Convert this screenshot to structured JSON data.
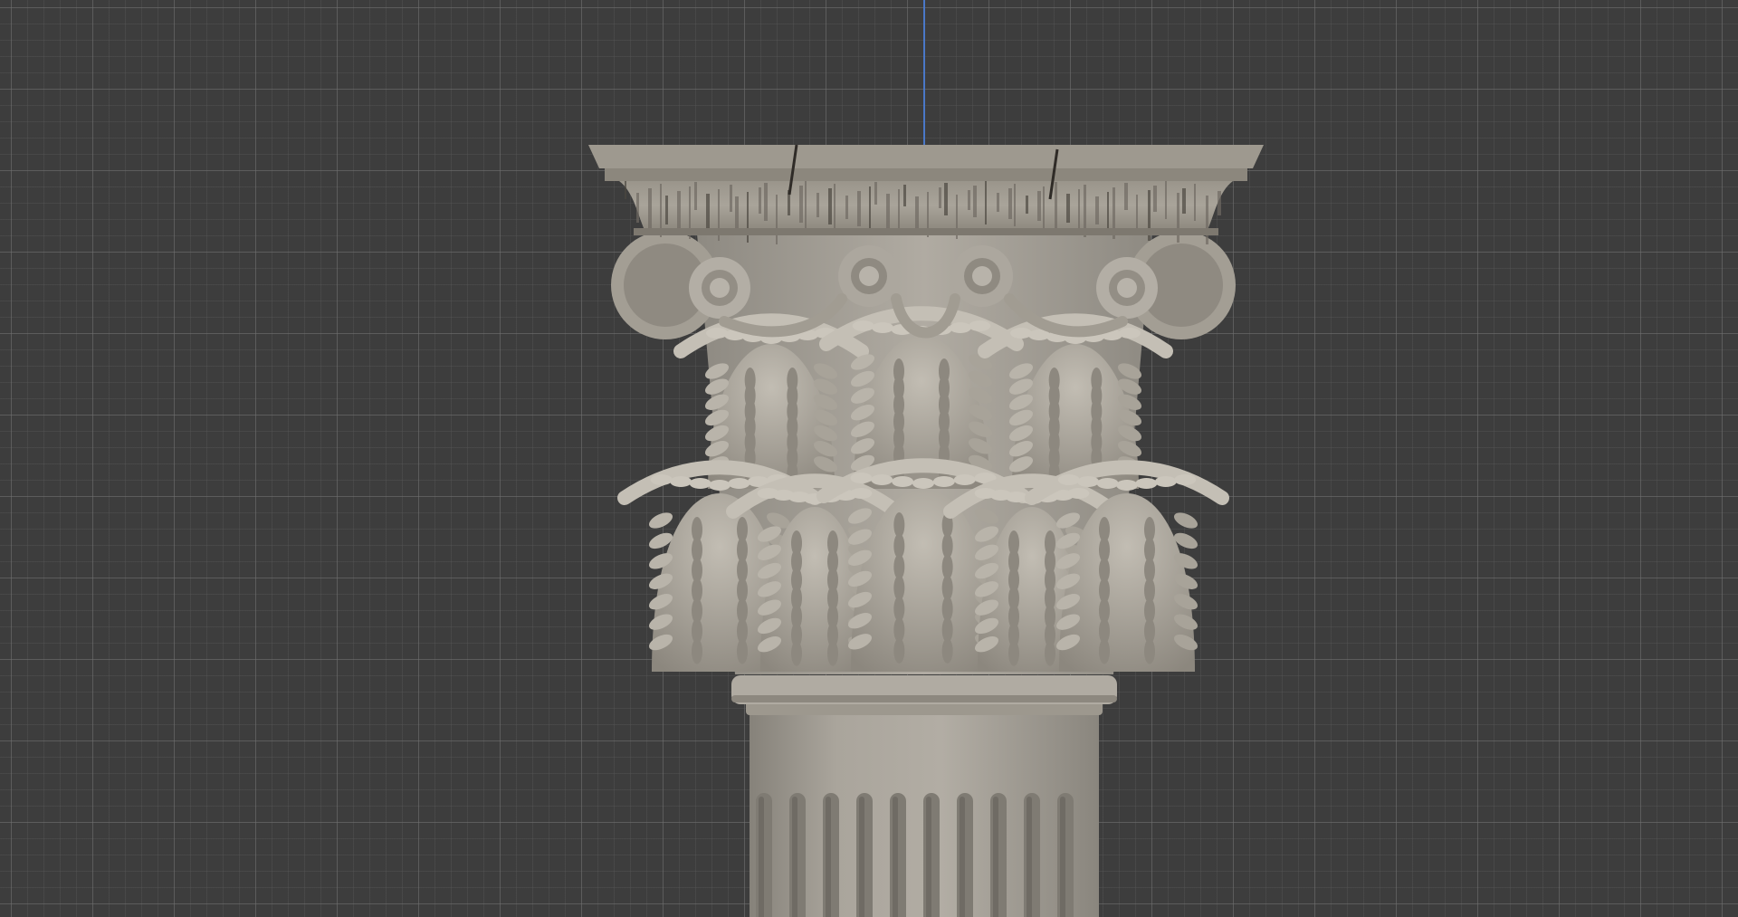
{
  "viewport": {
    "background_color": "#3d3d3d",
    "grid_color": "#6e6e6e",
    "z_axis_color": "#4a78c8"
  },
  "model": {
    "object": "corinthian-column-capital",
    "stone_color": "#aaa59c",
    "vein_color": "#4c4740",
    "flute_count": 10
  }
}
